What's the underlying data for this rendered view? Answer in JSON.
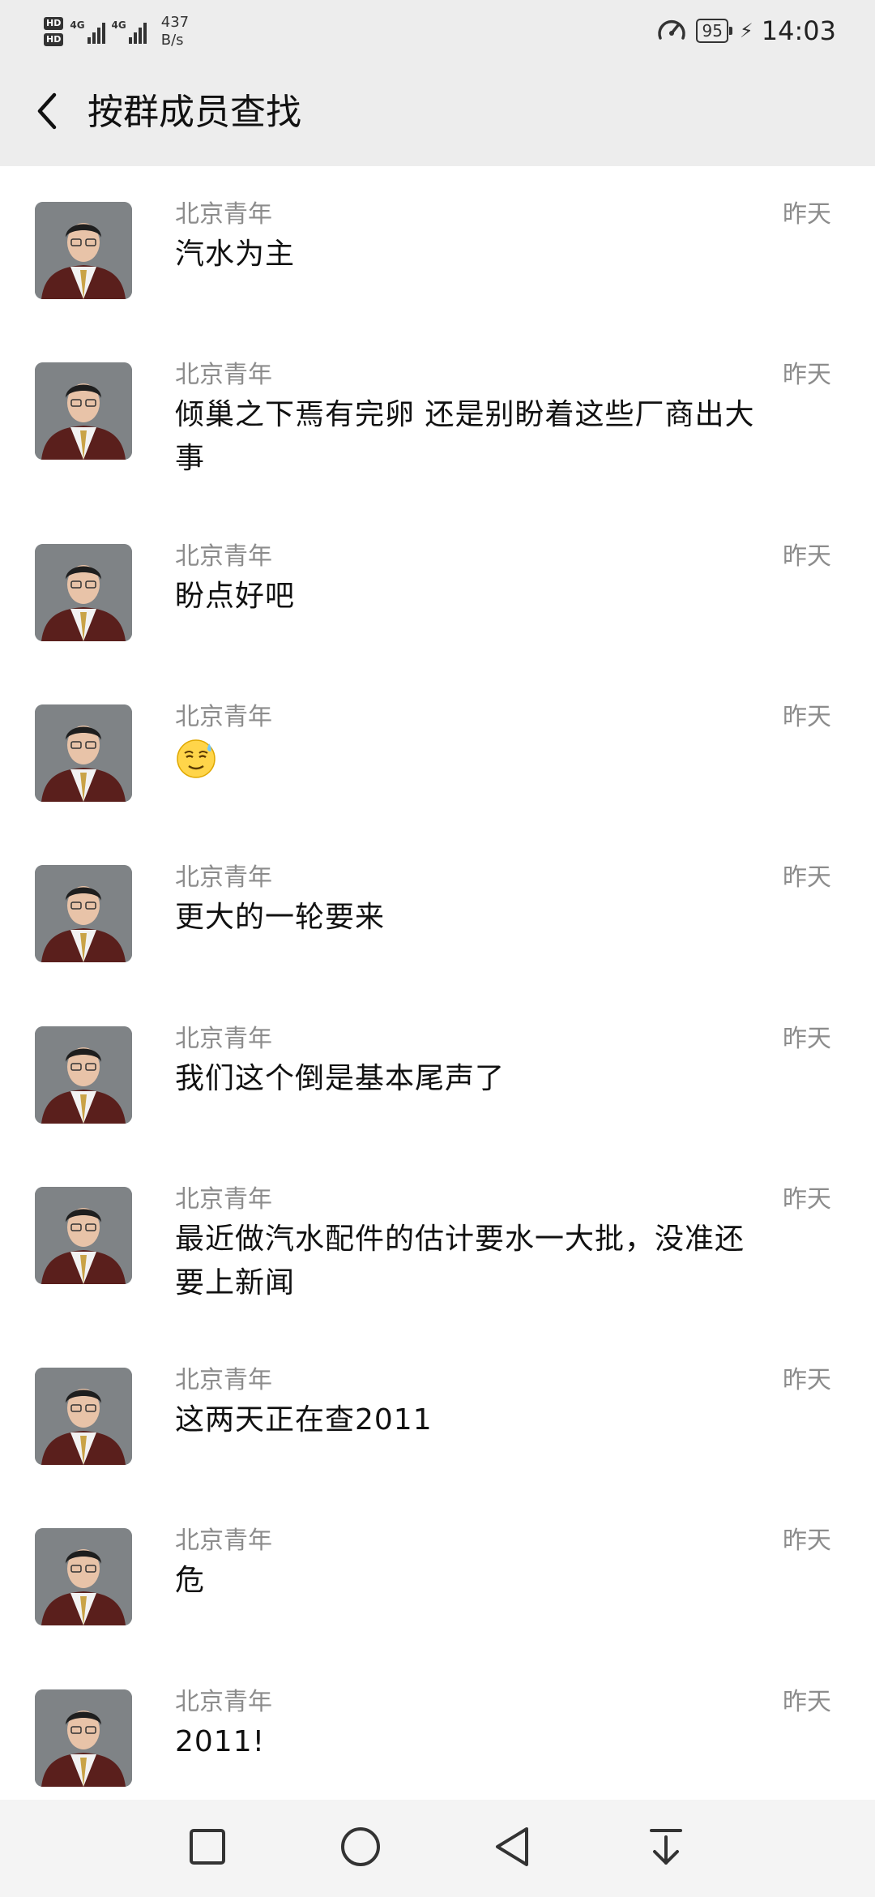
{
  "status_bar": {
    "hd1": "HD",
    "hd2": "HD",
    "net1": "4G",
    "net2": "4G",
    "speed_value": "437",
    "speed_unit": "B/s",
    "battery": "95",
    "time": "14:03"
  },
  "header": {
    "title": "按群成员查找"
  },
  "messages": [
    {
      "sender": "北京青年",
      "time": "昨天",
      "lines": [
        "汽水为主"
      ]
    },
    {
      "sender": "北京青年",
      "time": "昨天",
      "lines": [
        "倾巢之下焉有完卵 还是别盼着这些厂商出大",
        "事"
      ]
    },
    {
      "sender": "北京青年",
      "time": "昨天",
      "lines": [
        "盼点好吧"
      ]
    },
    {
      "sender": "北京青年",
      "time": "昨天",
      "emoji": "cold-sweat-smile-emoji"
    },
    {
      "sender": "北京青年",
      "time": "昨天",
      "lines": [
        "更大的一轮要来"
      ]
    },
    {
      "sender": "北京青年",
      "time": "昨天",
      "lines": [
        "我们这个倒是基本尾声了"
      ]
    },
    {
      "sender": "北京青年",
      "time": "昨天",
      "lines": [
        "最近做汽水配件的估计要水一大批，没准还",
        "要上新闻"
      ]
    },
    {
      "sender": "北京青年",
      "time": "昨天",
      "lines": [
        "这两天正在查2011"
      ]
    },
    {
      "sender": "北京青年",
      "time": "昨天",
      "lines": [
        "危"
      ]
    },
    {
      "sender": "北京青年",
      "time": "昨天",
      "lines": [
        "2011!"
      ]
    }
  ],
  "nav": {
    "recent_icon": "square-icon",
    "home_icon": "circle-icon",
    "back_icon": "triangle-back-icon",
    "notif_icon": "pull-down-icon"
  }
}
